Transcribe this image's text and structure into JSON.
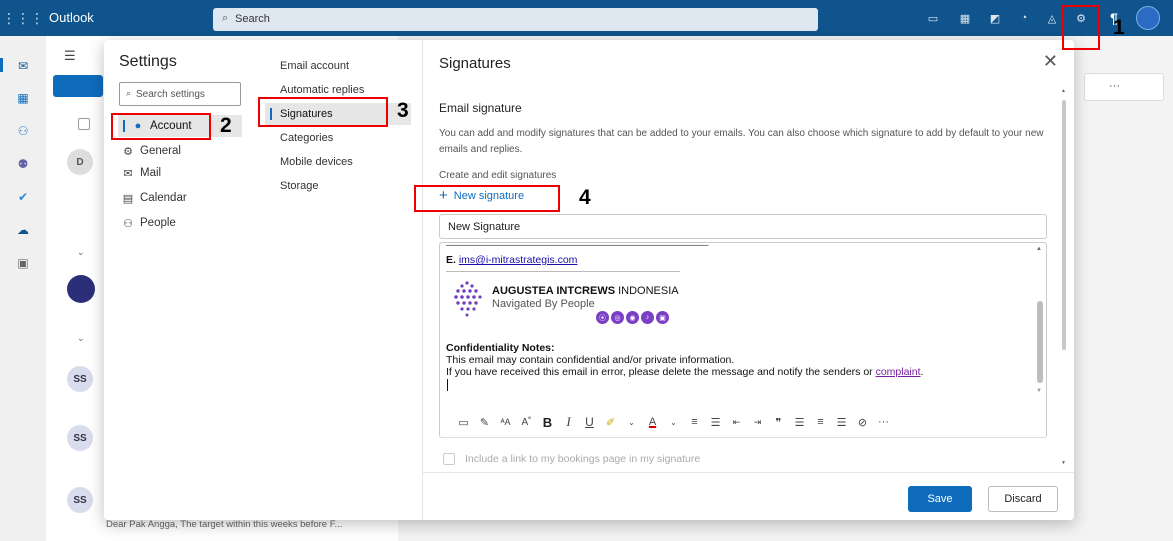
{
  "app": {
    "name": "Outlook"
  },
  "search": {
    "label": "Search"
  },
  "settings": {
    "title": "Settings",
    "search_placeholder": "Search settings",
    "nav": [
      {
        "label": "Account",
        "icon": "person-icon"
      },
      {
        "label": "General",
        "icon": "gear-icon"
      },
      {
        "label": "Mail",
        "icon": "mail-icon"
      },
      {
        "label": "Calendar",
        "icon": "calendar-icon"
      },
      {
        "label": "People",
        "icon": "people-icon"
      }
    ],
    "subnav": [
      "Email account",
      "Automatic replies",
      "Signatures",
      "Categories",
      "Mobile devices",
      "Storage"
    ]
  },
  "panel": {
    "title": "Signatures",
    "section": "Email signature",
    "description": "You can add and modify signatures that can be added to your emails. You can also choose which signature to add by default to your new emails and replies.",
    "create_label": "Create and edit signatures",
    "new_signature": "New signature",
    "signature_name": "New Signature",
    "bookings_label": "Include a link to my bookings page in my signature",
    "save": "Save",
    "discard": "Discard"
  },
  "signature": {
    "email_prefix": "E.",
    "email": "ims@i-mitrastrategis.com",
    "company_bold": "AUGUSTEA INTCREWS",
    "company_rest": " INDONESIA",
    "tagline": "Navigated By People",
    "conf_heading": "Confidentiality Notes:",
    "conf_line1": "This email may contain confidential and/or private information.",
    "conf_line2": "If you have received this email in error, please delete the message and notify the senders or ",
    "conf_link": "complaint",
    "conf_end": "."
  },
  "avatars": [
    "D",
    "SS",
    "SS",
    "SS"
  ],
  "message_preview": "Dear Pak Angga, The target within this weeks before F...",
  "annotations": [
    "1",
    "2",
    "3",
    "4"
  ],
  "colors": {
    "topbar": "#0f548c",
    "accent": "#0f6cbd",
    "highlight": "#e00000"
  }
}
